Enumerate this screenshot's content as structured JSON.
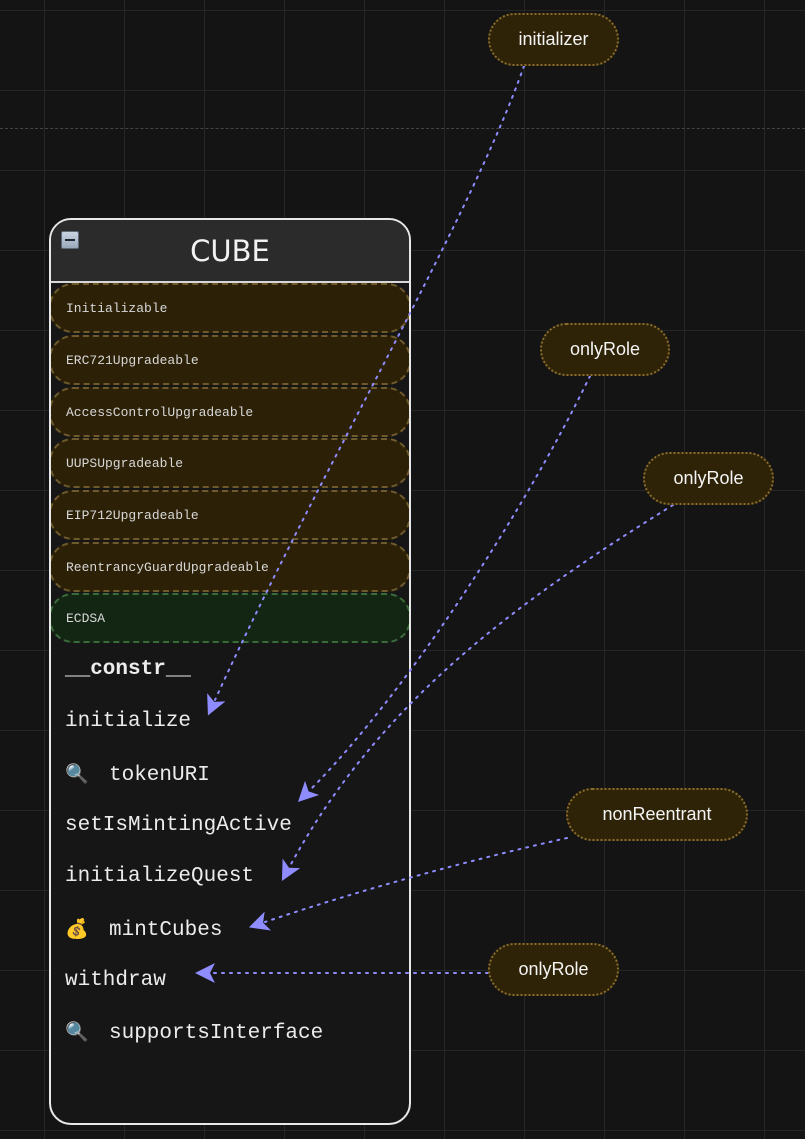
{
  "contract": {
    "title": "CUBE",
    "inheritances": [
      {
        "label": "Initializable",
        "kind": "upgradeable"
      },
      {
        "label": "ERC721Upgradeable",
        "kind": "upgradeable"
      },
      {
        "label": "AccessControlUpgradeable",
        "kind": "upgradeable"
      },
      {
        "label": "UUPSUpgradeable",
        "kind": "upgradeable"
      },
      {
        "label": "EIP712Upgradeable",
        "kind": "upgradeable"
      },
      {
        "label": "ReentrancyGuardUpgradeable",
        "kind": "upgradeable"
      },
      {
        "label": "ECDSA",
        "kind": "library"
      }
    ],
    "functions": [
      {
        "label": "__constr__",
        "icon": "",
        "emphasis": "bold"
      },
      {
        "label": "initialize",
        "icon": ""
      },
      {
        "label": "tokenURI",
        "icon": "🔍",
        "icon_name": "magnifier-icon"
      },
      {
        "label": "setIsMintingActive",
        "icon": ""
      },
      {
        "label": "initializeQuest",
        "icon": ""
      },
      {
        "label": "mintCubes",
        "icon": "💰",
        "icon_name": "money-bag-icon"
      },
      {
        "label": "withdraw",
        "icon": ""
      },
      {
        "label": "supportsInterface",
        "icon": "🔍",
        "icon_name": "magnifier-icon"
      }
    ]
  },
  "modifiers": [
    {
      "label": "initializer",
      "targets": "initialize"
    },
    {
      "label": "onlyRole",
      "targets": "setIsMintingActive"
    },
    {
      "label": "onlyRole",
      "targets": "initializeQuest"
    },
    {
      "label": "nonReentrant",
      "targets": "mintCubes"
    },
    {
      "label": "onlyRole",
      "targets": "withdraw"
    }
  ],
  "colors": {
    "background": "#141414",
    "edge": "#8f8cff",
    "modifier_fill": "#2e2307",
    "modifier_border": "#8a6d2c",
    "inherit_fill": "#2c2006",
    "library_fill": "#132513"
  }
}
